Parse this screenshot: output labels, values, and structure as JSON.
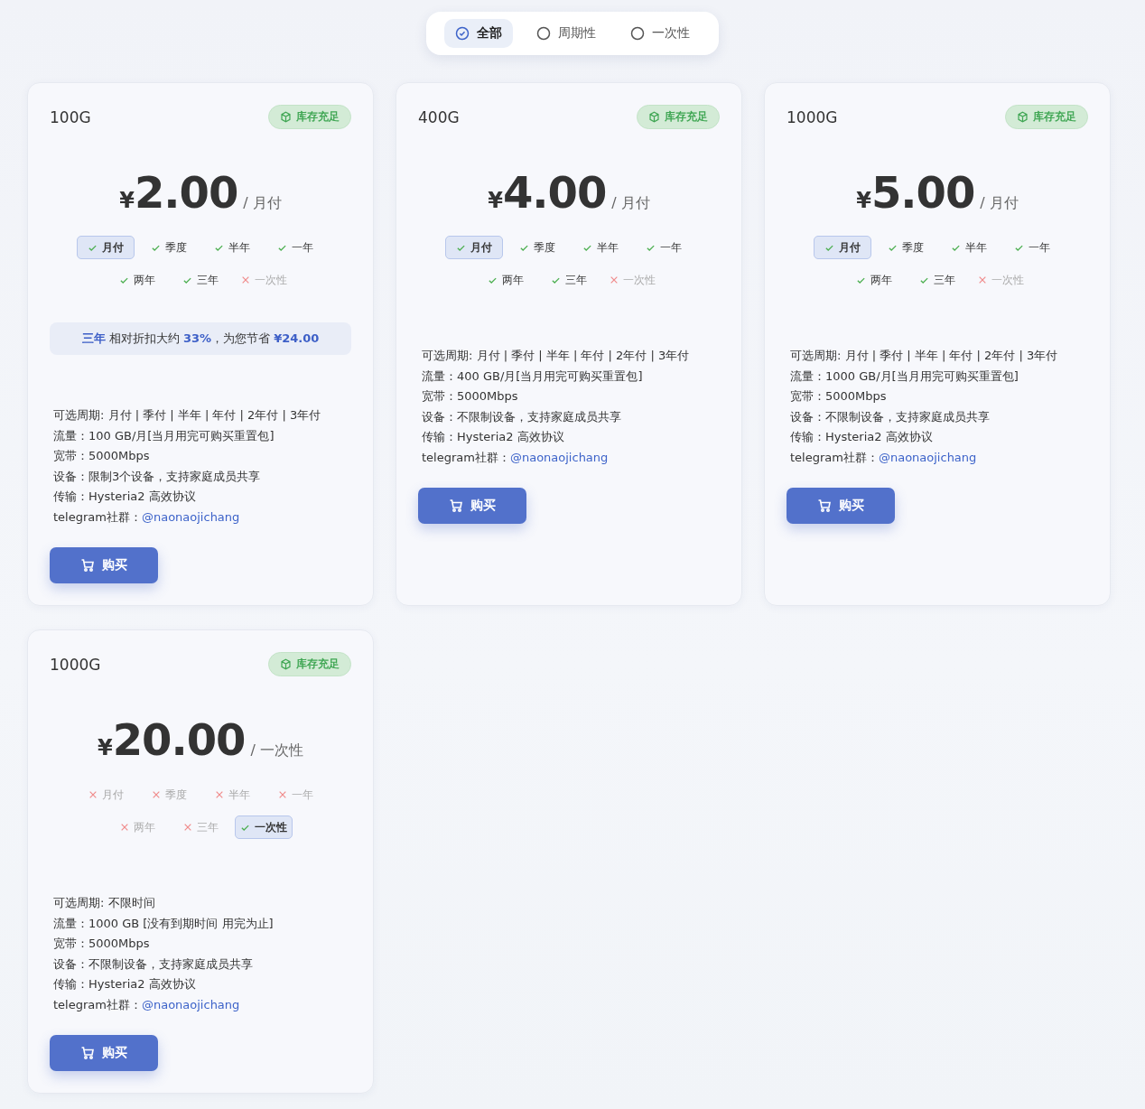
{
  "filters": [
    {
      "label": "全部",
      "selected": true
    },
    {
      "label": "周期性",
      "selected": false
    },
    {
      "label": "一次性",
      "selected": false
    }
  ],
  "plans": [
    {
      "title": "100G",
      "stock": "库存充足",
      "currency": "¥",
      "price": "2.00",
      "unit": "/ 月付",
      "periods": [
        {
          "label": "月付",
          "available": true,
          "selected": true
        },
        {
          "label": "季度",
          "available": true,
          "selected": false
        },
        {
          "label": "半年",
          "available": true,
          "selected": false
        },
        {
          "label": "一年",
          "available": true,
          "selected": false
        },
        {
          "label": "两年",
          "available": true,
          "selected": false
        },
        {
          "label": "三年",
          "available": true,
          "selected": false
        },
        {
          "label": "一次性",
          "available": false,
          "selected": false
        }
      ],
      "discount": "**三年** 相对折扣大约 **33%**，为您节省 **¥24.00**",
      "details": [
        {
          "text": "可选周期: 月付 | 季付 | 半年 | 年付 | 2年付 | 3年付"
        },
        {
          "text": "流量：100 GB/月[当月用完可购买重置包]"
        },
        {
          "text": "宽带：5000Mbps"
        },
        {
          "text": "设备：限制3个设备，支持家庭成员共享"
        },
        {
          "text": "传输：Hysteria2 高效协议"
        },
        {
          "text": "telegram社群：",
          "link": "@naonaojichang"
        }
      ],
      "button": "购买"
    },
    {
      "title": "400G",
      "stock": "库存充足",
      "currency": "¥",
      "price": "4.00",
      "unit": "/ 月付",
      "periods": [
        {
          "label": "月付",
          "available": true,
          "selected": true
        },
        {
          "label": "季度",
          "available": true,
          "selected": false
        },
        {
          "label": "半年",
          "available": true,
          "selected": false
        },
        {
          "label": "一年",
          "available": true,
          "selected": false
        },
        {
          "label": "两年",
          "available": true,
          "selected": false
        },
        {
          "label": "三年",
          "available": true,
          "selected": false
        },
        {
          "label": "一次性",
          "available": false,
          "selected": false
        }
      ],
      "details": [
        {
          "text": "可选周期: 月付 | 季付 | 半年 | 年付 | 2年付 | 3年付"
        },
        {
          "text": "流量：400 GB/月[当月用完可购买重置包]"
        },
        {
          "text": "宽带：5000Mbps"
        },
        {
          "text": "设备：不限制设备，支持家庭成员共享"
        },
        {
          "text": "传输：Hysteria2 高效协议"
        },
        {
          "text": "telegram社群：",
          "link": "@naonaojichang"
        }
      ],
      "button": "购买"
    },
    {
      "title": "1000G",
      "stock": "库存充足",
      "currency": "¥",
      "price": "5.00",
      "unit": "/ 月付",
      "periods": [
        {
          "label": "月付",
          "available": true,
          "selected": true
        },
        {
          "label": "季度",
          "available": true,
          "selected": false
        },
        {
          "label": "半年",
          "available": true,
          "selected": false
        },
        {
          "label": "一年",
          "available": true,
          "selected": false
        },
        {
          "label": "两年",
          "available": true,
          "selected": false
        },
        {
          "label": "三年",
          "available": true,
          "selected": false
        },
        {
          "label": "一次性",
          "available": false,
          "selected": false
        }
      ],
      "details": [
        {
          "text": "可选周期: 月付 | 季付 | 半年 | 年付 | 2年付 | 3年付"
        },
        {
          "text": "流量：1000 GB/月[当月用完可购买重置包]"
        },
        {
          "text": "宽带：5000Mbps"
        },
        {
          "text": "设备：不限制设备，支持家庭成员共享"
        },
        {
          "text": "传输：Hysteria2 高效协议"
        },
        {
          "text": "telegram社群：",
          "link": "@naonaojichang"
        }
      ],
      "button": "购买"
    },
    {
      "title": "1000G",
      "stock": "库存充足",
      "currency": "¥",
      "price": "20.00",
      "unit": "/ 一次性",
      "periods": [
        {
          "label": "月付",
          "available": false,
          "selected": false
        },
        {
          "label": "季度",
          "available": false,
          "selected": false
        },
        {
          "label": "半年",
          "available": false,
          "selected": false
        },
        {
          "label": "一年",
          "available": false,
          "selected": false
        },
        {
          "label": "两年",
          "available": false,
          "selected": false
        },
        {
          "label": "三年",
          "available": false,
          "selected": false
        },
        {
          "label": "一次性",
          "available": true,
          "selected": true
        }
      ],
      "details": [
        {
          "text": "可选周期: 不限时间"
        },
        {
          "text": "流量：1000 GB [没有到期时间 用完为止]"
        },
        {
          "text": "宽带：5000Mbps"
        },
        {
          "text": "设备：不限制设备，支持家庭成员共享"
        },
        {
          "text": "传输：Hysteria2 高效协议"
        },
        {
          "text": "telegram社群：",
          "link": "@naonaojichang"
        }
      ],
      "button": "购买"
    }
  ]
}
